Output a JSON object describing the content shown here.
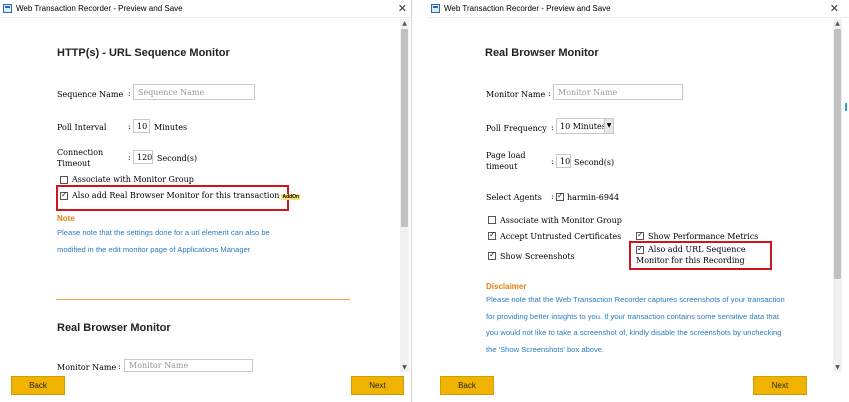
{
  "left": {
    "title": "Web Transaction Recorder - Preview and Save",
    "heading": "HTTP(s) - URL Sequence Monitor",
    "sequence_name_label": "Sequence Name",
    "sequence_name_placeholder": "Sequence Name",
    "poll_interval_label": "Poll Interval",
    "poll_interval_value": "10",
    "poll_interval_unit": "Minutes",
    "connection_timeout_label": "Connection Timeout",
    "connection_timeout_value": "120",
    "connection_timeout_unit": "Second(s)",
    "associate_label": "Associate with Monitor Group",
    "also_add_label": "Also add Real Browser Monitor for this transaction",
    "addons_badge": "AddOn",
    "note_heading": "Note",
    "note_text": "Please note that the settings done for a url element can also be modified in the edit monitor page of Applications Manager",
    "section2_heading": "Real Browser Monitor",
    "monitor_name_label": "Monitor Name",
    "monitor_name_placeholder": "Monitor Name",
    "back_label": "Back",
    "next_label": "Next"
  },
  "right": {
    "title": "Web Transaction Recorder - Preview and Save",
    "heading": "Real Browser Monitor",
    "monitor_name_label": "Monitor Name",
    "monitor_name_placeholder": "Monitor Name",
    "poll_frequency_label": "Poll Frequency",
    "poll_frequency_value": "10 Minutes",
    "page_load_timeout_label": "Page load timeout",
    "page_load_timeout_value": "10",
    "page_load_timeout_unit": "Second(s)",
    "select_agents_label": "Select Agents",
    "agent_name": "harmin-6944",
    "associate_label": "Associate with Monitor Group",
    "accept_certs_label": "Accept Untrusted Certificates",
    "show_perf_label": "Show Performance Metrics",
    "show_screenshots_label": "Show Screenshots",
    "also_add_label": "Also add URL Sequence Monitor for this Recording",
    "disclaimer_heading": "Disclaimer",
    "disclaimer_text": "Please note that the Web Transaction Recorder captures screenshots of your transaction for providing better insights to you. If your transaction contains some sensitive data that you would not like to take a screenshot of, kindly disable the screenshots by unchecking the 'Show Screenshots' box above.",
    "back_label": "Back",
    "next_label": "Next"
  },
  "colors": {
    "accent": "#f0b400",
    "highlight": "#d0151c",
    "note_text": "#2a7cc0",
    "note_heading": "#e0820f"
  }
}
